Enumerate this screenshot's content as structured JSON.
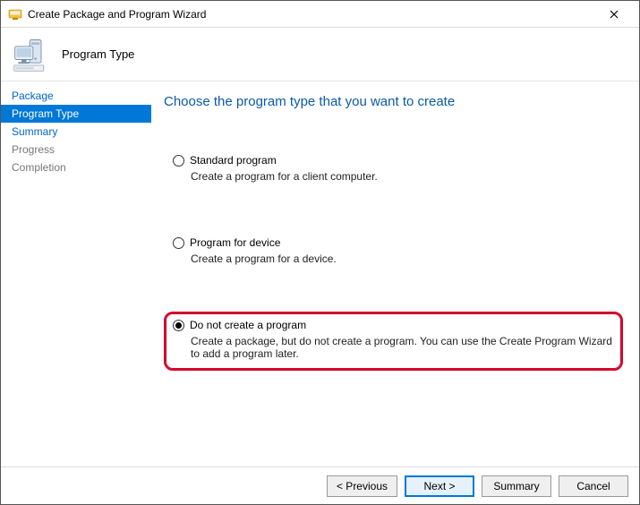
{
  "window": {
    "title": "Create Package and Program Wizard"
  },
  "header": {
    "page_name": "Program Type"
  },
  "sidebar": {
    "items": [
      {
        "label": "Package"
      },
      {
        "label": "Program Type"
      },
      {
        "label": "Summary"
      },
      {
        "label": "Progress"
      },
      {
        "label": "Completion"
      }
    ]
  },
  "main": {
    "heading": "Choose the program type that you want to create",
    "options": [
      {
        "label": "Standard program",
        "description": "Create a program for a client computer."
      },
      {
        "label": "Program for device",
        "description": "Create a program for a device."
      },
      {
        "label": "Do not create a program",
        "description": "Create a package, but do not create a program. You can use the Create Program Wizard to add a program later."
      }
    ]
  },
  "footer": {
    "previous": "< Previous",
    "next": "Next >",
    "summary": "Summary",
    "cancel": "Cancel"
  }
}
